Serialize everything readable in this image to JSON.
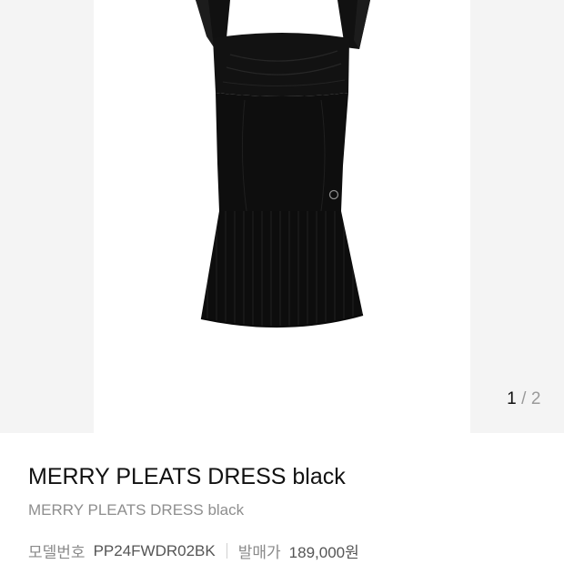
{
  "gallery": {
    "current_page": "1",
    "separator": "/",
    "total_pages": "2",
    "image_alt": "black pleated mini dress"
  },
  "product": {
    "title": "MERRY PLEATS DRESS black",
    "subtitle": "MERRY PLEATS DRESS black",
    "model_label": "모델번호",
    "model_number": "PP24FWDR02BK",
    "price_label": "발매가",
    "price": "189,000원"
  },
  "colors": {
    "gallery_background": "#f4f4f4",
    "dress": "#0d0d0d"
  }
}
